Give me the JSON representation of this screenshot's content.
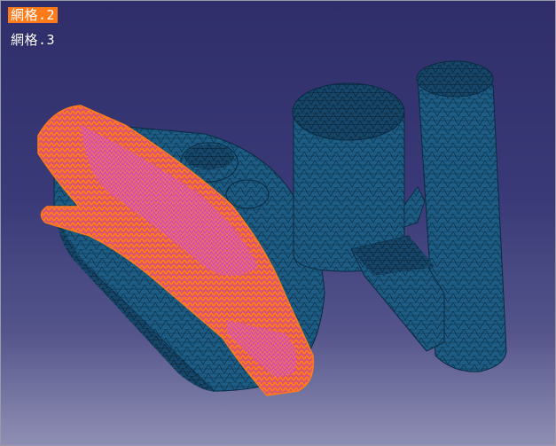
{
  "viewer": {
    "background_top": "#2f2e6a",
    "background_bottom": "#8f8fb4",
    "mesh_color": "#1c5a80",
    "mesh_line_color": "#0a2a40",
    "highlight_color": "#ff7a1a",
    "highlight_secondary": "#c03cb0"
  },
  "tree_labels": [
    {
      "label": "網格.2",
      "selected": true
    },
    {
      "label": "網格.3",
      "selected": false
    }
  ]
}
